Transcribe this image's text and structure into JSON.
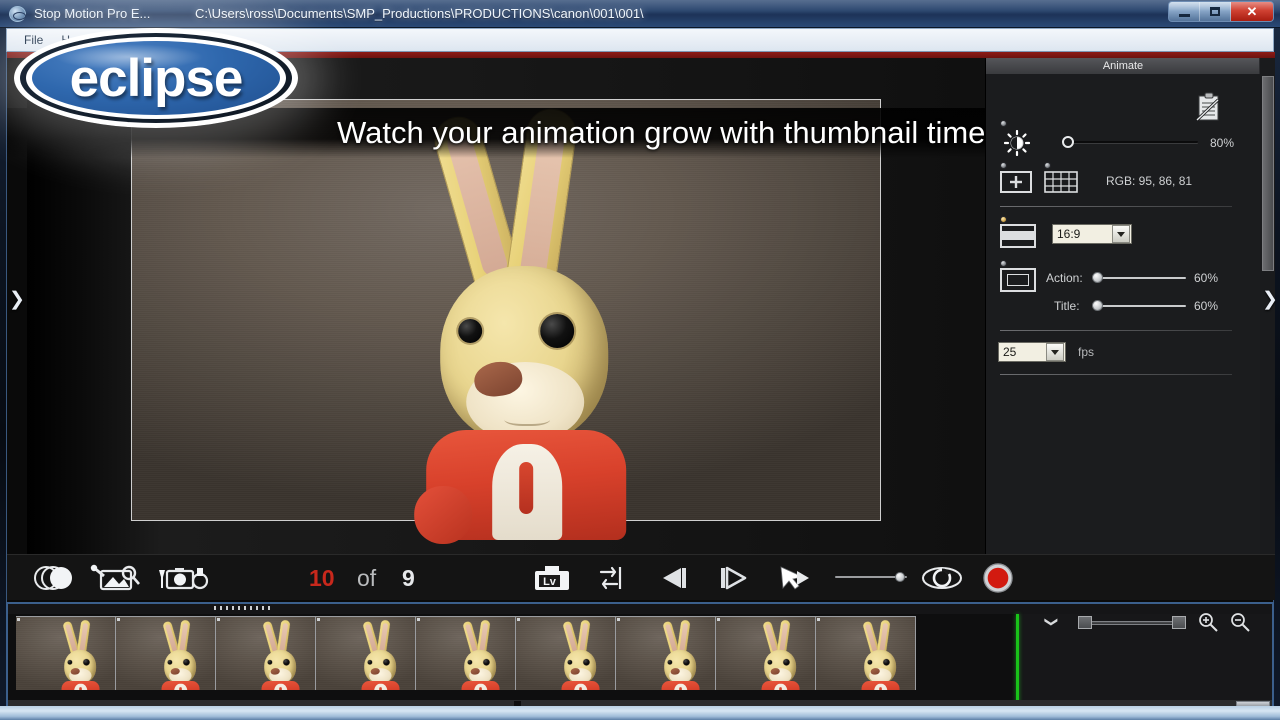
{
  "window": {
    "title": "Stop Motion Pro E...",
    "path": "C:\\Users\\ross\\Documents\\SMP_Productions\\PRODUCTIONS\\canon\\001\\001\\",
    "app_icon": "app-icon",
    "buttons": {
      "minimize": "minimize",
      "maximize": "maximize",
      "close": "✕"
    }
  },
  "menubar": {
    "items": [
      "File",
      "H"
    ]
  },
  "branding": {
    "logo_text": "eclipse"
  },
  "overlay": {
    "headline": "Watch your animation grow with thumbnail timeline"
  },
  "viewer": {
    "nav_left": "❯",
    "nav_right": "❯"
  },
  "dock": {
    "tab_label": "Animate",
    "clipboard_icon": "clipboard-icon",
    "brightness": {
      "icon": "brightness-icon",
      "value": "80%"
    },
    "grid": {
      "add_icon": "add-overlay-icon",
      "grid_icon": "grid-icon",
      "rgb_label": "RGB:  95, 86, 81"
    },
    "aspect": {
      "icon": "aspect-ratio-icon",
      "value": "16:9"
    },
    "safe_areas": {
      "icon": "safe-area-icon",
      "action_label": "Action:",
      "action_value": "60%",
      "title_label": "Title:",
      "title_value": "60%"
    },
    "framerate": {
      "value": "25",
      "unit": "fps"
    }
  },
  "controlbar": {
    "onion_skin": "onion-skin-icon",
    "image_review": "image-review-icon",
    "capture_setup": "capture-setup-icon",
    "frame_current": "10",
    "frame_of": "of",
    "frame_total": "9",
    "live_view": "Lv",
    "toggle": "toggle-live-capture-icon",
    "prev_frame": "prev-frame-icon",
    "next_frame": "next-frame-icon",
    "play": "play-pointer-icon",
    "speed_value": "",
    "eye": "onion-eye-icon",
    "record": "capture-record-button"
  },
  "timeline": {
    "thumbnail_count": 9,
    "thumb_label": "frame-thumbnail",
    "playhead": "playhead",
    "chevron": "❯",
    "zoom_in": "zoom-in-icon",
    "zoom_out": "zoom-out-icon",
    "segments": {
      "grey": "captured",
      "white": "pending",
      "red": "current"
    }
  },
  "colors": {
    "accent_red": "#c8281c",
    "playhead_green": "#19c219",
    "brand_blue": "#2f68ae",
    "title_blue": "#24406a"
  }
}
